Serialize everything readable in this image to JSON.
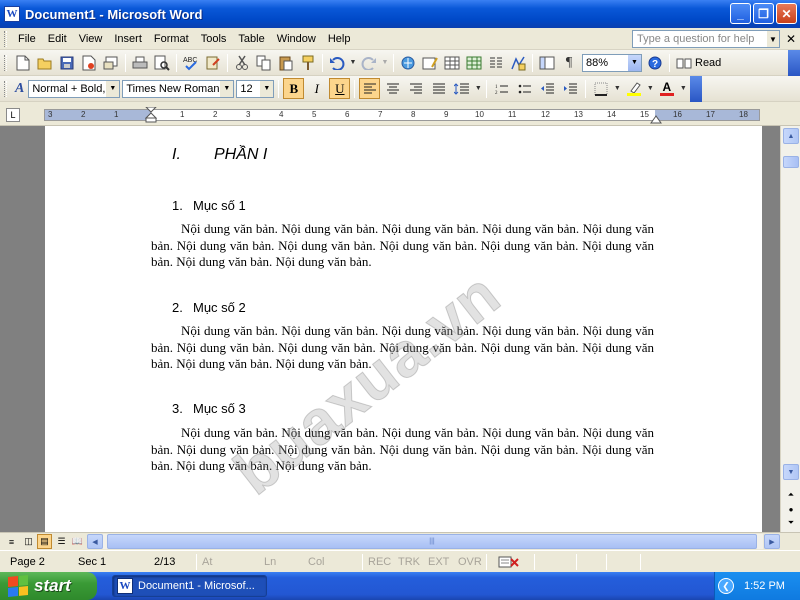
{
  "window": {
    "title": "Document1 - Microsoft Word",
    "app_icon": "W"
  },
  "menu": {
    "items": [
      "File",
      "Edit",
      "View",
      "Insert",
      "Format",
      "Tools",
      "Table",
      "Window",
      "Help"
    ],
    "help_placeholder": "Type a question for help"
  },
  "standard_toolbar": {
    "zoom": "88%",
    "read_label": "Read"
  },
  "formatting_toolbar": {
    "style": "Normal + Bold,",
    "font": "Times New Roman",
    "size": "12",
    "bold_label": "B",
    "italic_label": "I",
    "underline_label": "U",
    "font_color_label": "A"
  },
  "ruler": {
    "tab_selector": "L",
    "numbers": [
      "3",
      "2",
      "1",
      "1",
      "2",
      "3",
      "4",
      "5",
      "6",
      "7",
      "8",
      "9",
      "10",
      "11",
      "12",
      "13",
      "14",
      "15",
      "16",
      "17",
      "18"
    ]
  },
  "document": {
    "heading": {
      "number": "I.",
      "text": "PHẦN I"
    },
    "sections": [
      {
        "number": "1.",
        "title": "Mục số 1",
        "body": "Nội dung văn bản. Nội dung văn bản. Nội dung văn bản. Nội dung văn bản. Nội dung văn bản. Nội dung văn bản. Nội dung văn bản. Nội dung văn bản. Nội dung văn bản. Nội dung văn bản. Nội dung văn bản. Nội dung văn bản."
      },
      {
        "number": "2.",
        "title": "Mục số 2",
        "body": "Nội dung văn bản. Nội dung văn bản. Nội dung văn bản. Nội dung văn bản. Nội dung văn bản. Nội dung văn bản. Nội dung văn bản. Nội dung văn bản. Nội dung văn bản. Nội dung văn bản. Nội dung văn bản. Nội dung văn bản."
      },
      {
        "number": "3.",
        "title": "Mục số 3",
        "body": "Nội dung văn bản. Nội dung văn bản. Nội dung văn bản. Nội dung văn bản. Nội dung văn bản. Nội dung văn bản. Nội dung văn bản. Nội dung văn bản. Nội dung văn bản. Nội dung văn bản. Nội dung văn bản. Nội dung văn bản."
      }
    ],
    "watermark": "buaxua.vn"
  },
  "status_bar": {
    "page": "Page 2",
    "sec": "Sec 1",
    "pages": "2/13",
    "at": "At",
    "ln": "Ln",
    "col": "Col",
    "rec": "REC",
    "trk": "TRK",
    "ext": "EXT",
    "ovr": "OVR"
  },
  "taskbar": {
    "start_label": "start",
    "task_label": "Document1 - Microsof...",
    "clock": "1:52 PM"
  },
  "colors": {
    "titlebar": "#0a58d8",
    "start_green": "#3a9a36",
    "active_button": "#fcd58c",
    "font_color_red": "#e02020",
    "highlight_yellow": "#ffff00"
  }
}
